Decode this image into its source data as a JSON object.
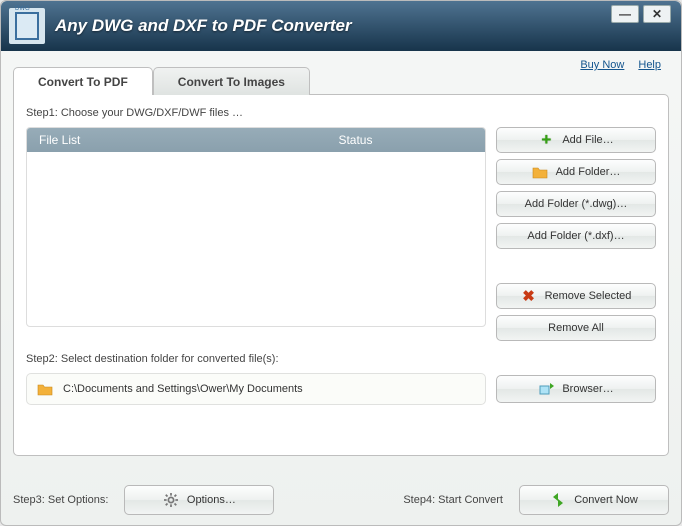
{
  "titlebar": {
    "title": "Any DWG and DXF to PDF Converter"
  },
  "links": {
    "buy_now": "Buy Now",
    "help": "Help"
  },
  "tabs": {
    "convert_pdf": "Convert To PDF",
    "convert_images": "Convert To Images"
  },
  "step1": {
    "label": "Step1: Choose your DWG/DXF/DWF files    …",
    "col_file": "File List",
    "col_status": "Status"
  },
  "buttons": {
    "add_file": "Add File…",
    "add_folder": "Add Folder…",
    "add_folder_dwg": "Add Folder (*.dwg)…",
    "add_folder_dxf": "Add Folder (*.dxf)…",
    "remove_selected": "Remove Selected",
    "remove_all": "Remove All",
    "browser": "Browser…",
    "options": "Options…",
    "convert_now": "Convert Now"
  },
  "step2": {
    "label": "Step2: Select destination folder for converted file(s):",
    "path": "C:\\Documents and Settings\\Ower\\My Documents"
  },
  "step3": {
    "label": "Step3: Set Options:"
  },
  "step4": {
    "label": "Step4: Start Convert"
  }
}
